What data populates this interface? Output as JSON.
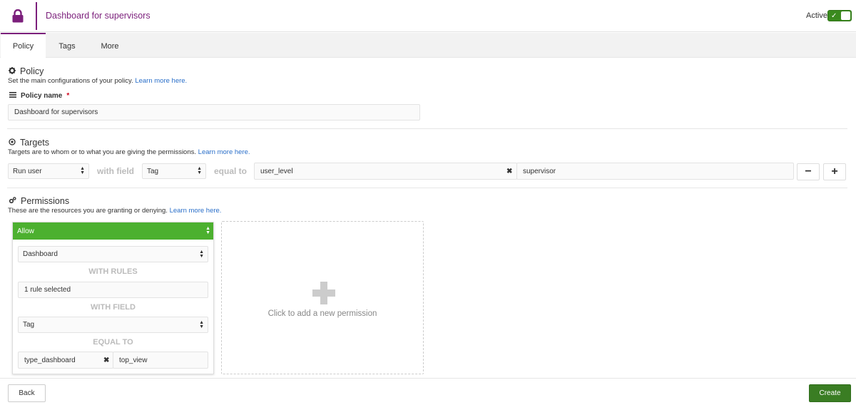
{
  "header": {
    "title": "Dashboard for supervisors",
    "active_label": "Active",
    "toggle_check": "✓"
  },
  "tabs": [
    {
      "label": "Policy"
    },
    {
      "label": "Tags"
    },
    {
      "label": "More"
    }
  ],
  "policy": {
    "title": "Policy",
    "description": "Set the main configurations of your policy.",
    "learn_more": "Learn more here.",
    "name_label": "Policy name",
    "required_mark": "*",
    "name_value": "Dashboard for supervisors"
  },
  "targets": {
    "title": "Targets",
    "description": "Targets are to whom or to what you are giving the permissions.",
    "learn_more": "Learn more here.",
    "type_select": "Run user",
    "with_field_label": "with field",
    "field_select": "Tag",
    "equal_to_label": "equal to",
    "key_value": "user_level",
    "value_value": "supervisor",
    "clear_mark": "✖",
    "remove_label": "−",
    "add_label": "+"
  },
  "permissions": {
    "title": "Permissions",
    "description": "These are the resources you are granting or denying.",
    "learn_more": "Learn more here.",
    "card": {
      "effect": "Allow",
      "resource": "Dashboard",
      "with_rules_label": "WITH RULES",
      "rules_value": "1 rule selected",
      "with_field_label": "WITH FIELD",
      "field_select": "Tag",
      "equal_to_label": "EQUAL TO",
      "key_value": "type_dashboard",
      "clear_mark": "✖",
      "value_value": "top_view"
    },
    "add_text": "Click to add a new permission"
  },
  "footer": {
    "back_label": "Back",
    "create_label": "Create"
  },
  "colors": {
    "brand": "#7b1f7b",
    "allow_green": "#4cb02f",
    "create_green": "#3a7d23",
    "link": "#2a6fc9"
  }
}
